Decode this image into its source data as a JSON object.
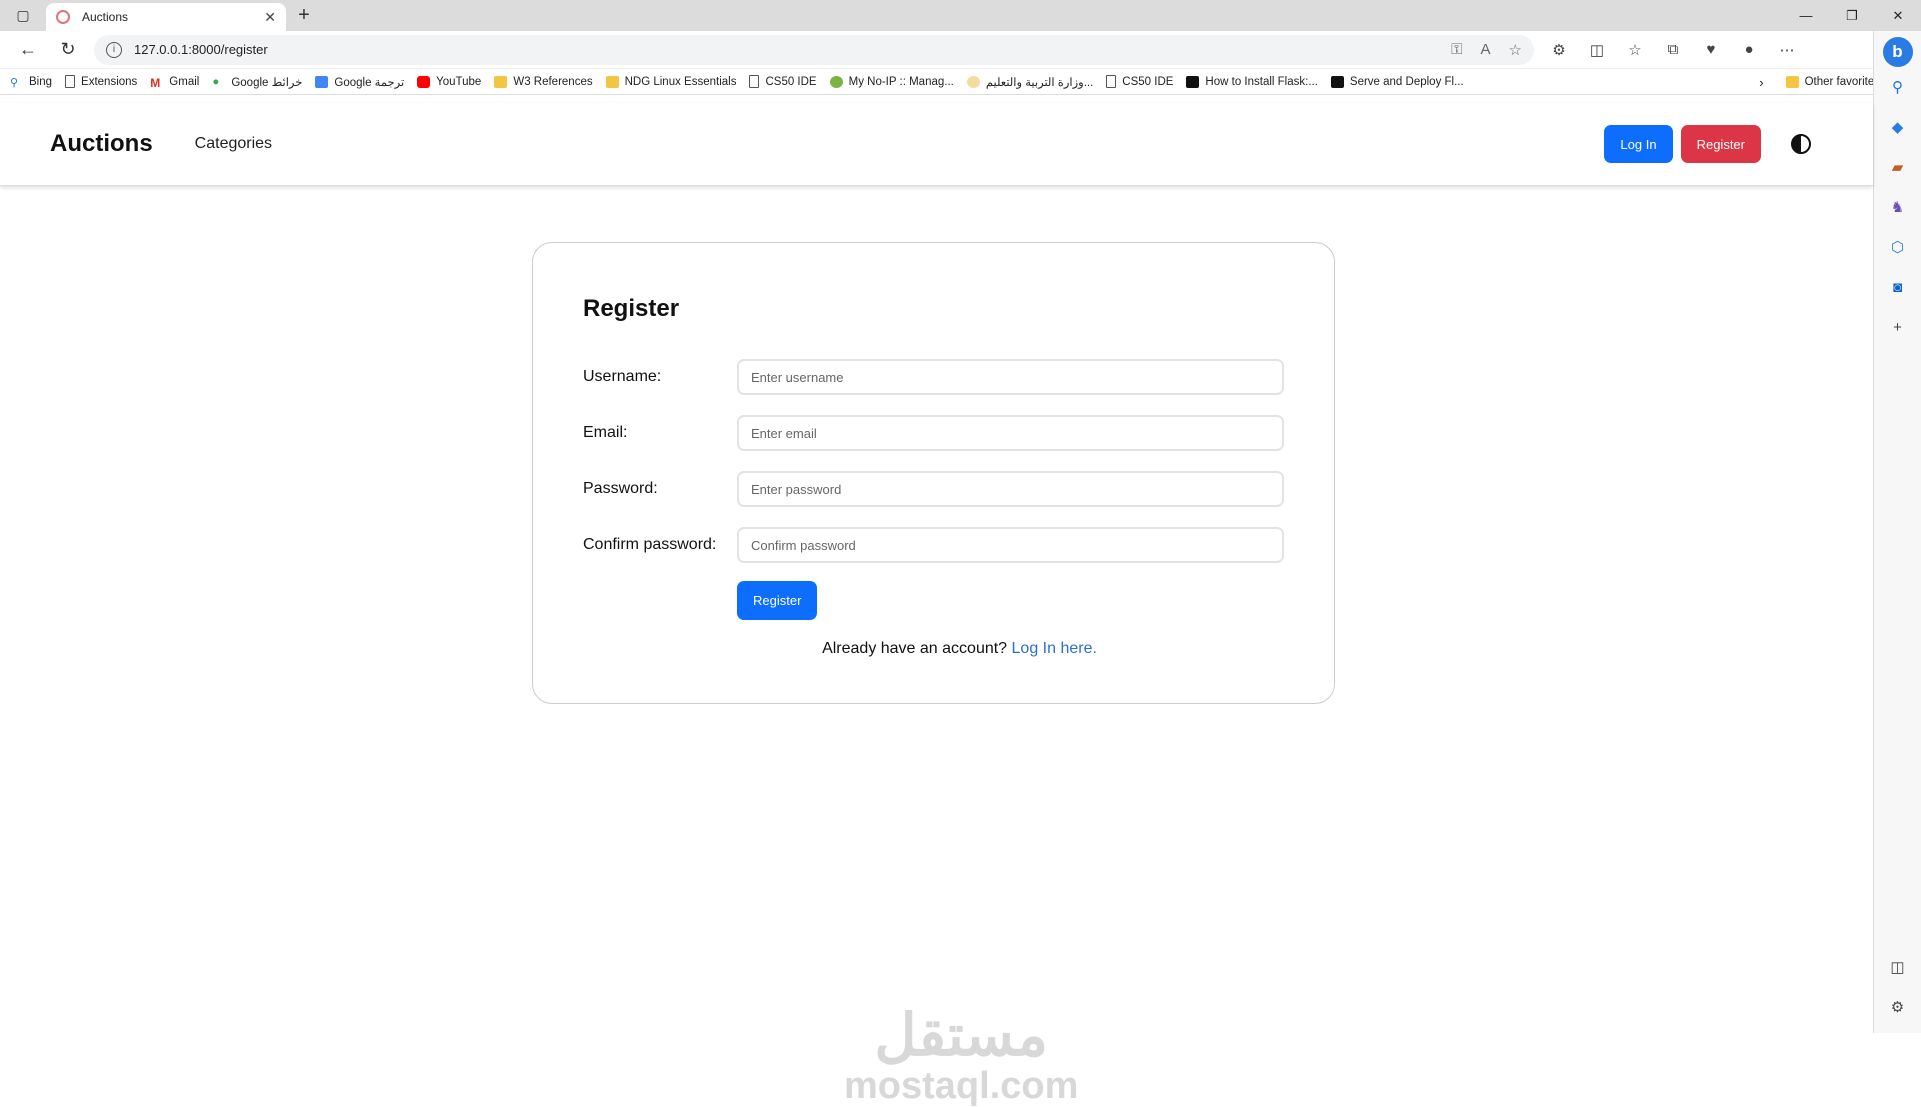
{
  "browser": {
    "tab_title": "Auctions",
    "url": "127.0.0.1:8000/register",
    "bookmarks": [
      "Bing",
      "Extensions",
      "Gmail",
      "Google خرائط",
      "Google ترجمة",
      "YouTube",
      "W3 References",
      "NDG Linux Essentials",
      "CS50 IDE",
      "My No-IP :: Manag...",
      "وزارة التربية والتعليم...",
      "CS50 IDE",
      "How to Install Flask:...",
      "Serve and Deploy Fl..."
    ],
    "other_favorites": "Other favorites"
  },
  "site": {
    "brand": "Auctions",
    "nav_categories": "Categories",
    "login_button": "Log In",
    "register_button": "Register"
  },
  "form": {
    "title": "Register",
    "username_label": "Username:",
    "username_placeholder": "Enter username",
    "email_label": "Email:",
    "email_placeholder": "Enter email",
    "password_label": "Password:",
    "password_placeholder": "Enter password",
    "confirm_label": "Confirm password:",
    "confirm_placeholder": "Confirm password",
    "submit_label": "Register",
    "already_text": "Already have an account?",
    "login_link": "Log In here."
  },
  "watermark": {
    "arabic": "مستقل",
    "latin": "mostaql.com"
  }
}
